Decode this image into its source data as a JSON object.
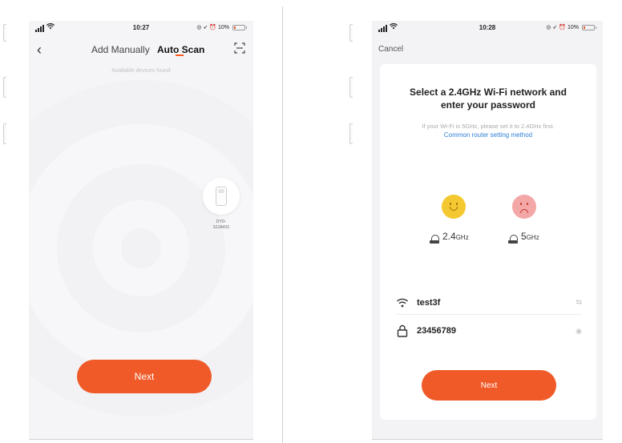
{
  "phone1": {
    "status_bar": {
      "time": "10:27",
      "battery": "10%"
    },
    "nav": {
      "back_icon": "chevron-left-icon",
      "tab_manual": "Add Manually",
      "tab_auto": "Auto Scan",
      "scan_icon": "qr-scan-icon"
    },
    "available_text": "Available devices found",
    "device": {
      "icon": "dehumidifier-icon",
      "name_line1": "DYD-",
      "name_line2": "S12A431"
    },
    "next_label": "Next",
    "colors": {
      "accent": "#f05a28",
      "tab_indicator": "#ff5a1f"
    }
  },
  "phone2": {
    "status_bar": {
      "time": "10:28",
      "battery": "10%"
    },
    "cancel_label": "Cancel",
    "title_line1": "Select a 2.4GHz Wi-Fi network and",
    "title_line2": "enter your password",
    "hint_text": "If your Wi-Fi is 5GHz, please set it to 2.4GHz first.",
    "router_link": "Common router setting method",
    "bands": [
      {
        "face": "happy-face-icon",
        "router_icon": "router-icon",
        "number": "2.4",
        "unit": "GHz"
      },
      {
        "face": "sad-face-icon",
        "router_icon": "router-icon",
        "number": "5",
        "unit": "GHz"
      }
    ],
    "wifi_field": {
      "icon": "wifi-icon",
      "value": "test3f",
      "action_icon": "swap-arrows-icon",
      "action_glyph": "⇆"
    },
    "password_field": {
      "icon": "lock-icon",
      "value": "23456789",
      "action_icon": "eye-icon",
      "action_glyph": "◉"
    },
    "next_label": "Next",
    "colors": {
      "accent": "#f05a28",
      "link": "#2f7fd8",
      "happy": "#f4c830",
      "sad": "#f4a7a7"
    }
  }
}
